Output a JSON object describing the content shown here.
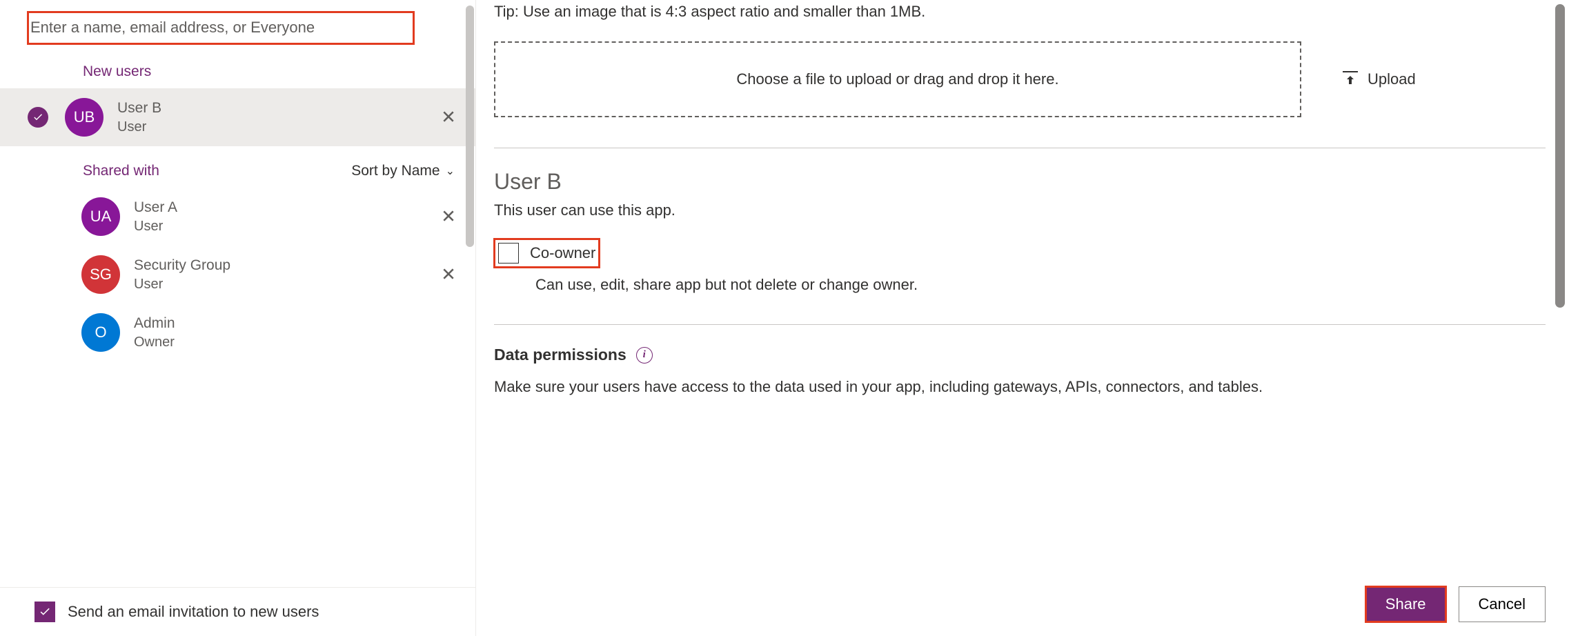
{
  "search": {
    "placeholder": "Enter a name, email address, or Everyone"
  },
  "sections": {
    "new_users": "New users",
    "shared_with": "Shared with",
    "sort_label": "Sort by Name"
  },
  "users": {
    "selected": {
      "initials": "UB",
      "name": "User B",
      "role": "User"
    },
    "shared": [
      {
        "initials": "UA",
        "name": "User A",
        "role": "User",
        "color": "purple",
        "removable": true
      },
      {
        "initials": "SG",
        "name": "Security Group",
        "role": "User",
        "color": "red",
        "removable": true
      },
      {
        "initials": "O",
        "name": "Admin",
        "role": "Owner",
        "color": "blue",
        "removable": false
      }
    ]
  },
  "email_invite": {
    "label": "Send an email invitation to new users"
  },
  "upload": {
    "tip": "Tip: Use an image that is 4:3 aspect ratio and smaller than 1MB.",
    "dropzone": "Choose a file to upload or drag and drop it here.",
    "button": "Upload"
  },
  "detail": {
    "title": "User B",
    "subtitle": "This user can use this app.",
    "coowner_label": "Co-owner",
    "coowner_desc": "Can use, edit, share app but not delete or change owner."
  },
  "data_permissions": {
    "heading": "Data permissions",
    "text": "Make sure your users have access to the data used in your app, including gateways, APIs, connectors, and tables."
  },
  "footer": {
    "share": "Share",
    "cancel": "Cancel"
  }
}
